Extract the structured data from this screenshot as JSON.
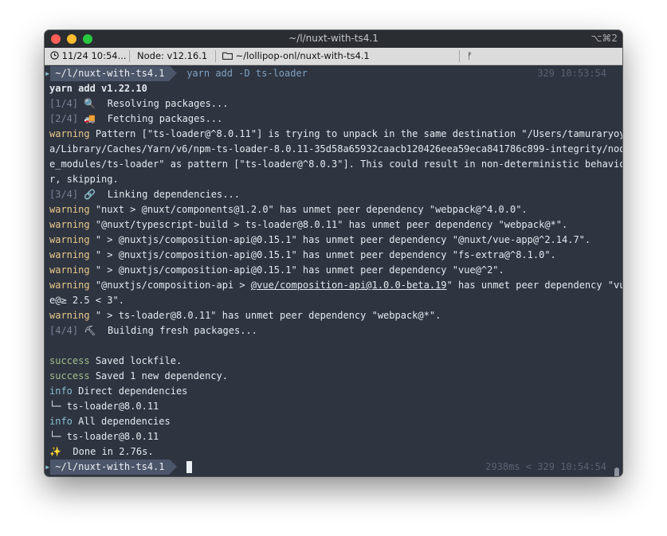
{
  "window": {
    "title": "~/l/nuxt-with-ts4.1",
    "shortcut": "⌥⌘2"
  },
  "statusbar": {
    "clock": "11/24 10:54...",
    "node": "Node: v12.16.1",
    "path": "~/lollipop-onl/nuxt-with-ts4.1",
    "branch_icon": "ᚠ"
  },
  "prompt": {
    "dir": "~/l/nuxt-with-ts4.1",
    "command": "yarn add -D ts-loader",
    "right_top": "329 10:53:54",
    "right_bottom_time": "2938ms",
    "right_bottom_sep": "<",
    "right_bottom_info": "329 10:54:54"
  },
  "output": {
    "yarn_version": "yarn add v1.22.10",
    "step1": "[1/4]",
    "step1_icon": "🔍",
    "step1_text": "Resolving packages...",
    "step2": "[2/4]",
    "step2_icon": "🚚",
    "step2_text": "Fetching packages...",
    "warning": "warning",
    "warn1_l1": "Pattern [\"ts-loader@^8.0.11\"] is trying to unpack in the same destination \"/Users/tamuraryoy",
    "warn1_l2": "a/Library/Caches/Yarn/v6/npm-ts-loader-8.0.11-35d58a65932caacb120426eea59eca841786c899-integrity/nod",
    "warn1_l3": "e_modules/ts-loader\" as pattern [\"ts-loader@^8.0.3\"]. This could result in non-deterministic behavio",
    "warn1_l4": "r, skipping.",
    "step3": "[3/4]",
    "step3_icon": "🔗",
    "step3_text": "Linking dependencies...",
    "warn2": "\"nuxt > @nuxt/components@1.2.0\" has unmet peer dependency \"webpack@^4.0.0\".",
    "warn3": "\"@nuxt/typescript-build > ts-loader@8.0.11\" has unmet peer dependency \"webpack@*\".",
    "warn4": "\" > @nuxtjs/composition-api@0.15.1\" has unmet peer dependency \"@nuxt/vue-app@^2.14.7\".",
    "warn5": "\" > @nuxtjs/composition-api@0.15.1\" has unmet peer dependency \"fs-extra@^8.1.0\".",
    "warn6": "\" > @nuxtjs/composition-api@0.15.1\" has unmet peer dependency \"vue@^2\".",
    "warn7_pre": "\"@nuxtjs/composition-api > ",
    "warn7_link": "@vue/composition-api@1.0.0-beta.19",
    "warn7_post": "\" has unmet peer dependency \"vu",
    "warn7_l2": "e@≥ 2.5 < 3\".",
    "warn8": "\" > ts-loader@8.0.11\" has unmet peer dependency \"webpack@*\".",
    "step4": "[4/4]",
    "step4_icon": "⛏",
    "step4_text": "Building fresh packages...",
    "success": "success",
    "succ1": "Saved lockfile.",
    "succ2": "Saved 1 new dependency.",
    "info": "info",
    "info1": "Direct dependencies",
    "tree1": "└─ ts-loader@8.0.11",
    "info2": "All dependencies",
    "tree2": "└─ ts-loader@8.0.11",
    "done_icon": "✨",
    "done": "Done in 2.76s."
  },
  "colors": {
    "terminal_bg": "#2e3440",
    "warning": "#ebcb8b",
    "success": "#a3be8c",
    "info": "#88c0d0",
    "command": "#81a1c1"
  }
}
